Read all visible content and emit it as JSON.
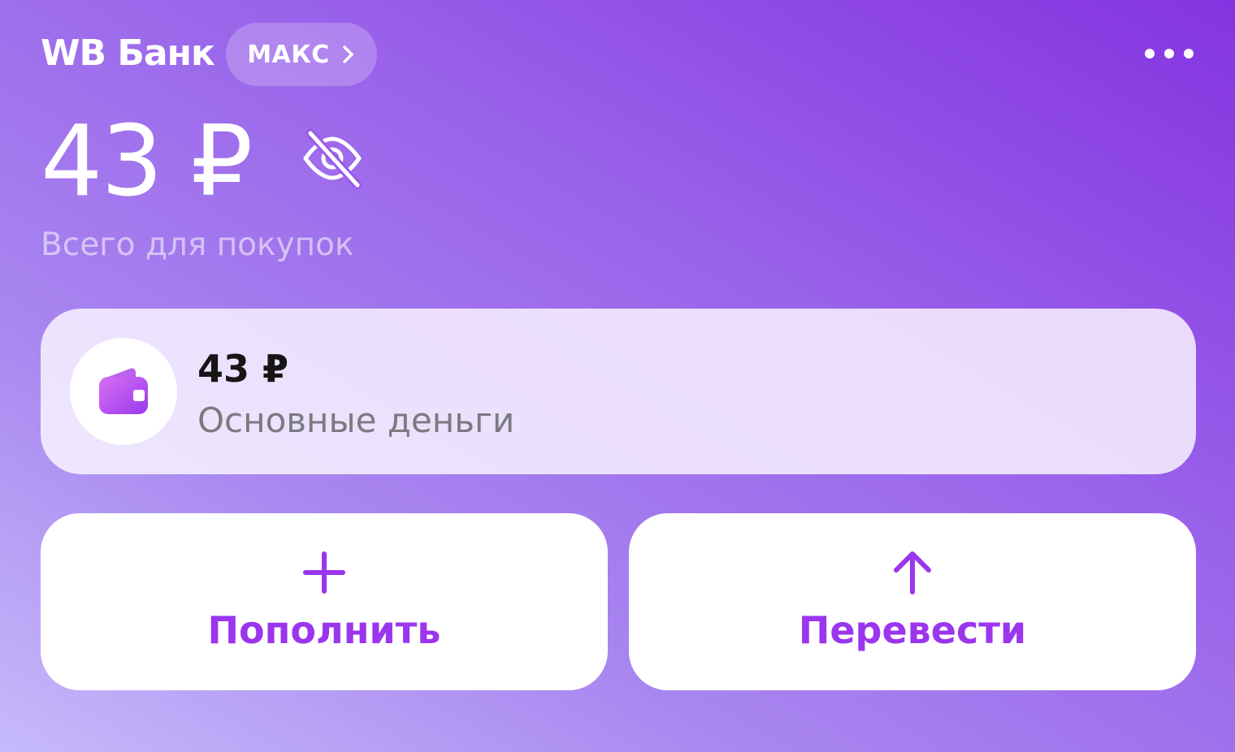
{
  "header": {
    "brand": "WB Банк",
    "tier_label": "МАКС",
    "icons": {
      "tier_chevron": "chevron-right-icon",
      "more": "more-dots-icon"
    }
  },
  "balance": {
    "amount": "43 ₽",
    "caption": "Всего для покупок",
    "visibility_icon": "eye-off-icon"
  },
  "account": {
    "amount": "43 ₽",
    "name": "Основные деньги",
    "icon": "wallet-icon"
  },
  "actions": [
    {
      "label": "Пополнить",
      "icon": "plus-icon"
    },
    {
      "label": "Перевести",
      "icon": "arrow-up-icon"
    }
  ],
  "colors": {
    "accent": "#9b35ee",
    "gradient_top": "#8434e0",
    "gradient_bottom": "#c6bafa",
    "card_background": "#ffffff"
  }
}
